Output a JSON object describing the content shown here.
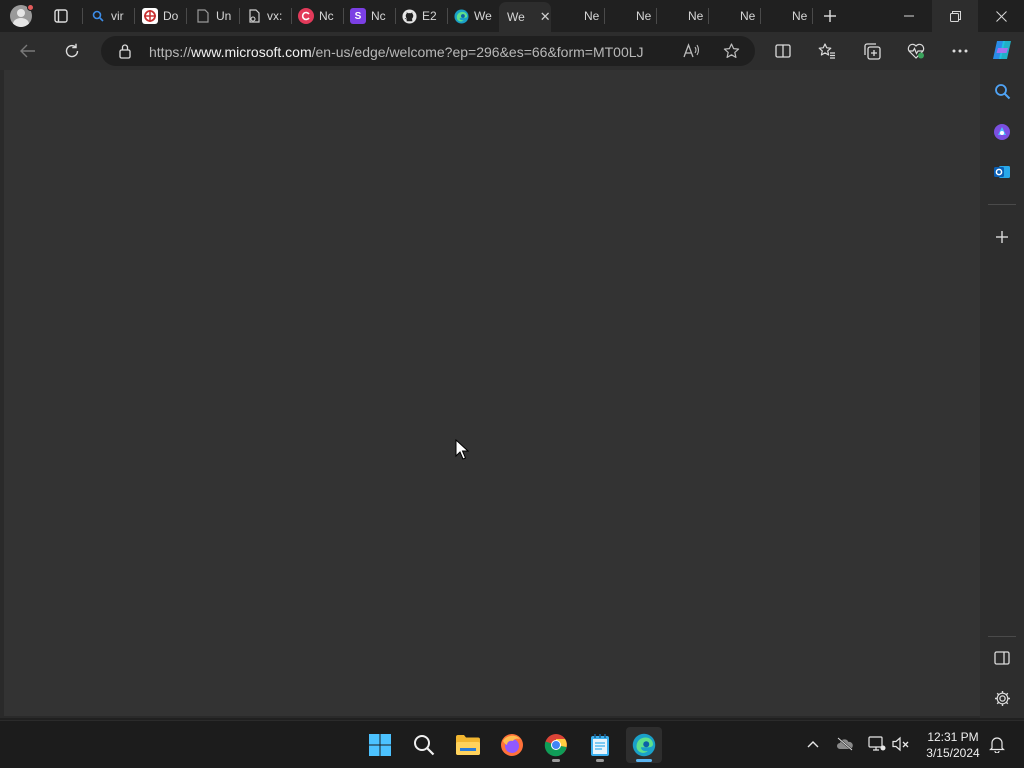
{
  "browser": {
    "tabs": [
      {
        "label": "vir",
        "icon": "search-icon"
      },
      {
        "label": "Do",
        "icon": "target-favicon-icon"
      },
      {
        "label": "Un",
        "icon": "document-icon"
      },
      {
        "label": "vx:",
        "icon": "file-link-icon"
      },
      {
        "label": "Nc",
        "icon": "red-circle-favicon-icon"
      },
      {
        "label": "Nc",
        "icon": "s-favicon-icon"
      },
      {
        "label": "E2",
        "icon": "github-icon"
      },
      {
        "label": "We",
        "icon": "edge-icon"
      },
      {
        "label": "We",
        "icon": "close-icon",
        "active": true
      },
      {
        "label": "Ne"
      },
      {
        "label": "Ne"
      },
      {
        "label": "Ne"
      },
      {
        "label": "Ne"
      },
      {
        "label": "Ne"
      }
    ],
    "address": {
      "url_prefix": "https://",
      "url_host": "www.microsoft.com",
      "url_path": "/en-us/edge/welcome?ep=296&es=66&form=MT00LJ"
    }
  },
  "taskbar": {
    "apps": [
      "windows-start",
      "search",
      "file-explorer",
      "firefox",
      "chrome",
      "notepad",
      "edge"
    ],
    "clock": {
      "time": "12:31 PM",
      "date": "3/15/2024"
    }
  },
  "colors": {
    "content_bg": "#333333",
    "tabstrip_bg": "#202020",
    "toolbar_bg": "#2d2d2d",
    "accent": "#5ab4f0"
  }
}
